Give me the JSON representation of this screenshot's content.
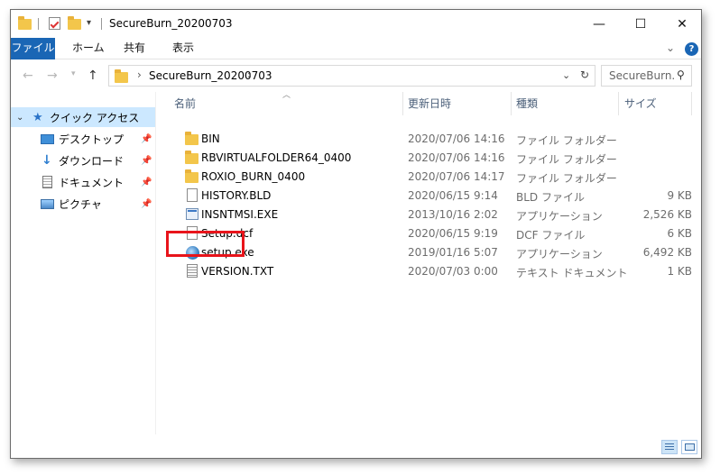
{
  "window": {
    "title": "SecureBurn_20200703",
    "minimize": "—",
    "maximize": "☐",
    "close": "✕"
  },
  "ribbon": {
    "tabs": [
      "ファイル",
      "ホーム",
      "共有",
      "表示"
    ],
    "collapse": "⌄",
    "help": "?"
  },
  "address": {
    "path": "SecureBurn_20200703",
    "breadcrumb_chevron": "›",
    "search_placeholder": "SecureBurn..."
  },
  "sidebar": {
    "items": [
      {
        "label": "クイック アクセス",
        "icon": "star-icon"
      },
      {
        "label": "デスクトップ",
        "icon": "desktop-icon",
        "pinned": true
      },
      {
        "label": "ダウンロード",
        "icon": "download-icon",
        "pinned": true
      },
      {
        "label": "ドキュメント",
        "icon": "document-icon",
        "pinned": true
      },
      {
        "label": "ピクチャ",
        "icon": "pictures-icon",
        "pinned": true
      }
    ]
  },
  "columns": {
    "name": "名前",
    "date": "更新日時",
    "type": "種類",
    "size": "サイズ"
  },
  "files": [
    {
      "name": "BIN",
      "date": "2020/07/06 14:16",
      "type": "ファイル フォルダー",
      "size": "",
      "icon": "folder-icon"
    },
    {
      "name": "RBVIRTUALFOLDER64_0400",
      "date": "2020/07/06 14:16",
      "type": "ファイル フォルダー",
      "size": "",
      "icon": "folder-icon"
    },
    {
      "name": "ROXIO_BURN_0400",
      "date": "2020/07/06 14:17",
      "type": "ファイル フォルダー",
      "size": "",
      "icon": "folder-icon"
    },
    {
      "name": "HISTORY.BLD",
      "date": "2020/06/15 9:14",
      "type": "BLD ファイル",
      "size": "9 KB",
      "icon": "file-icon"
    },
    {
      "name": "INSNTMSI.EXE",
      "date": "2013/10/16 2:02",
      "type": "アプリケーション",
      "size": "2,526 KB",
      "icon": "exe-icon"
    },
    {
      "name": "Setup.dcf",
      "date": "2020/06/15 9:19",
      "type": "DCF ファイル",
      "size": "6 KB",
      "icon": "file-icon"
    },
    {
      "name": "setup.exe",
      "date": "2019/01/16 5:07",
      "type": "アプリケーション",
      "size": "6,492 KB",
      "icon": "setup-icon"
    },
    {
      "name": "VERSION.TXT",
      "date": "2020/07/03 0:00",
      "type": "テキスト ドキュメント",
      "size": "1 KB",
      "icon": "text-file-icon"
    }
  ],
  "colors": {
    "ribbon_file_tab": "#1a66b5",
    "selection": "#cce8ff",
    "highlight_box": "#e8141b",
    "folder": "#f3c64b"
  }
}
